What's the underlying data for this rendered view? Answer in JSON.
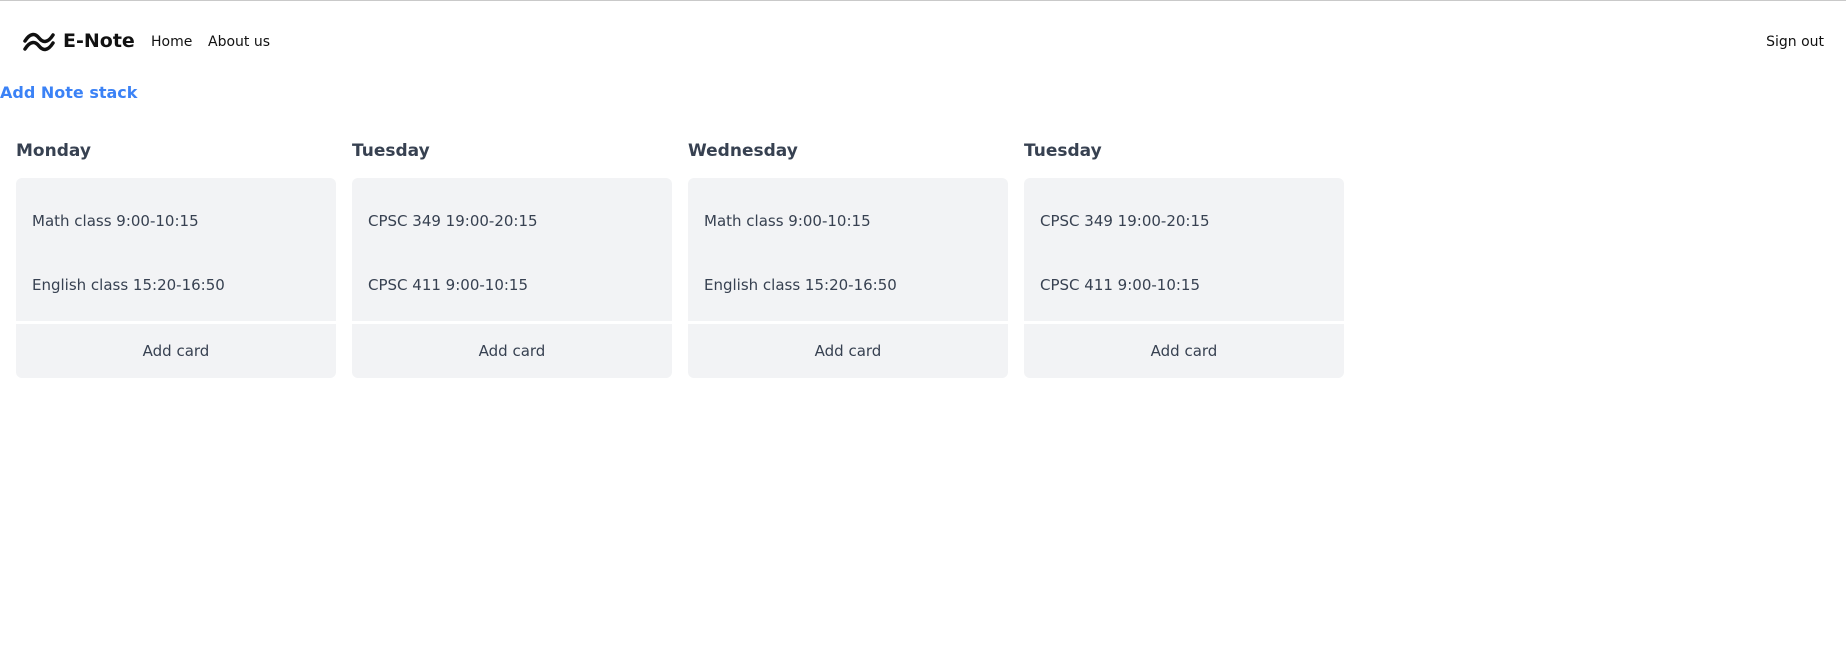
{
  "navbar": {
    "brand": "E-Note",
    "links": [
      "Home",
      "About us"
    ],
    "sign_out": "Sign out",
    "logo_icon": "wave-logo-icon"
  },
  "actions": {
    "add_note_stack": "Add Note stack"
  },
  "colors": {
    "accent": "#3b82f6",
    "card_bg": "#f2f3f5",
    "text": "#374151"
  },
  "stacks": [
    {
      "title": "Monday",
      "cards": [
        "Math class 9:00-10:15",
        "English class 15:20-16:50"
      ],
      "add_label": "Add card"
    },
    {
      "title": "Tuesday",
      "cards": [
        "CPSC 349 19:00-20:15",
        "CPSC 411 9:00-10:15"
      ],
      "add_label": "Add card"
    },
    {
      "title": "Wednesday",
      "cards": [
        "Math class 9:00-10:15",
        "English class 15:20-16:50"
      ],
      "add_label": "Add card"
    },
    {
      "title": "Tuesday",
      "cards": [
        "CPSC 349 19:00-20:15",
        "CPSC 411 9:00-10:15"
      ],
      "add_label": "Add card"
    }
  ]
}
